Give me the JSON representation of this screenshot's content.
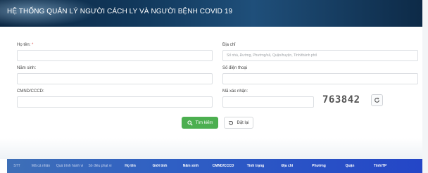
{
  "header": {
    "title": "HỆ THỐNG QUẢN LÝ NGƯỜI CÁCH LY VÀ NGƯỜI BỆNH COVID 19"
  },
  "form": {
    "full_name": {
      "label": "Họ tên:",
      "required_mark": "*",
      "value": ""
    },
    "address": {
      "label": "Địa chỉ",
      "placeholder": "Số nhà, Đường, Phường/xã, Quận/huyện, Tỉnh/thành phố",
      "value": ""
    },
    "birth_year": {
      "label": "Năm sinh:",
      "value": ""
    },
    "phone": {
      "label": "Số điện thoại",
      "value": ""
    },
    "id_number": {
      "label": "CMND/CCCD:",
      "value": ""
    },
    "captcha": {
      "label": "Mã xác nhận:",
      "value": "",
      "code": "763842"
    }
  },
  "buttons": {
    "search_label": "Tìm kiếm",
    "reset_label": "Đặt lại"
  },
  "table": {
    "columns": [
      "STT",
      "Mã cá nhân",
      "Quá trình hành vi",
      "Số điều phạt vi",
      "Họ tên",
      "Giới tính",
      "Năm sinh",
      "CMND/CCCD",
      "Tình trạng",
      "Địa chỉ",
      "Phường",
      "Quận",
      "Tỉnh/TP"
    ]
  },
  "colors": {
    "banner": "#123a5e",
    "search_button": "#4caf50",
    "table_header": "#2f5fc4"
  }
}
